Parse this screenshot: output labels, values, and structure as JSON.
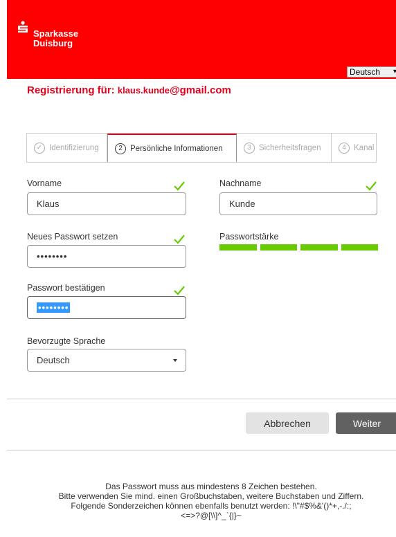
{
  "header": {
    "brand_line1": "Sparkasse",
    "brand_line2": "Duisburg",
    "brand_color": "#ff0000",
    "language_selected": "Deutsch"
  },
  "title": {
    "prefix": "Registrierung für:",
    "email_user": "klaus.kunde",
    "email_domain": "@gmail.com"
  },
  "steps": [
    {
      "num": "✓",
      "label": "Identifizierung",
      "state": "done"
    },
    {
      "num": "2",
      "label": "Persönliche Informationen",
      "state": "active"
    },
    {
      "num": "3",
      "label": "Sicherheitsfragen",
      "state": "pending"
    },
    {
      "num": "4",
      "label": "Kanal",
      "state": "pending"
    }
  ],
  "form": {
    "first_name_label": "Vorname",
    "first_name_value": "Klaus",
    "last_name_label": "Nachname",
    "last_name_value": "Kunde",
    "new_password_label": "Neues Passwort setzen",
    "new_password_value": "••••••••",
    "strength_label": "Passwortstärke",
    "strength_level": "4/4",
    "confirm_password_label": "Passwort bestätigen",
    "confirm_password_value": "••••••••",
    "language_label": "Bevorzugte Sprache",
    "language_value": "Deutsch",
    "valid_color": "#66cc00"
  },
  "actions": {
    "cancel_label": "Abbrechen",
    "next_label": "Weiter"
  },
  "info": {
    "line1": "Das Passwort muss aus mindestens 8 Zeichen bestehen.",
    "line2": "Bitte verwenden Sie mind. einen Großbuchstaben, weitere Buchstaben und Ziffern.",
    "line3": "Folgende Sonderzeichen können ebenfalls benutzt werden: !\\\"#$%&'()*+,-./:;",
    "line4": "<=>?@[\\\\]^_`{|}~"
  }
}
